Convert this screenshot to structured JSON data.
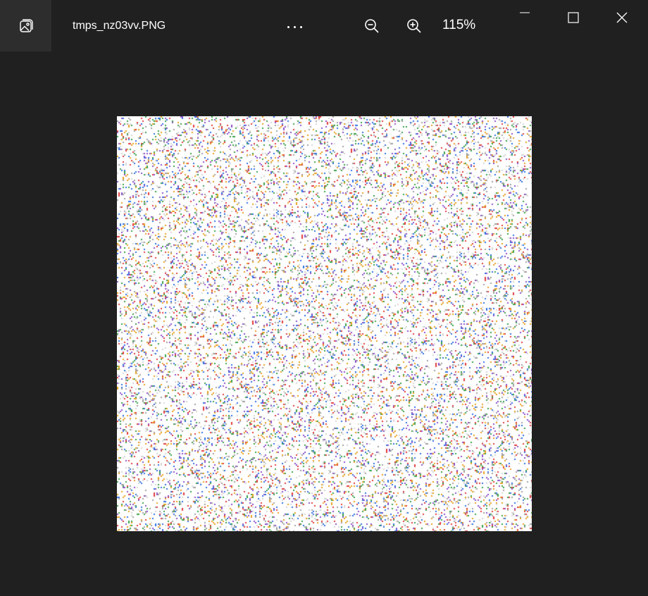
{
  "window": {
    "file_name": "tmps_nz03vv.PNG",
    "zoom_level": "115%"
  },
  "toolbar": {
    "app_icon": "image-gallery-icon",
    "more_icon": "more-options-icon",
    "zoom_out_icon": "zoom-out-icon",
    "zoom_in_icon": "zoom-in-icon"
  },
  "caption_buttons": {
    "minimize_icon": "minimize-icon",
    "maximize_icon": "maximize-icon",
    "close_icon": "close-icon"
  },
  "colors": {
    "background": "#202020",
    "app_icon_bg": "#2d2d2d",
    "image_bg": "#ffffff",
    "noise_palette": [
      "#e03c3c",
      "#2f6fe0",
      "#e8a020",
      "#3aa04a",
      "#8a50c8",
      "#d4d4d4",
      "#a0a0a0"
    ]
  }
}
